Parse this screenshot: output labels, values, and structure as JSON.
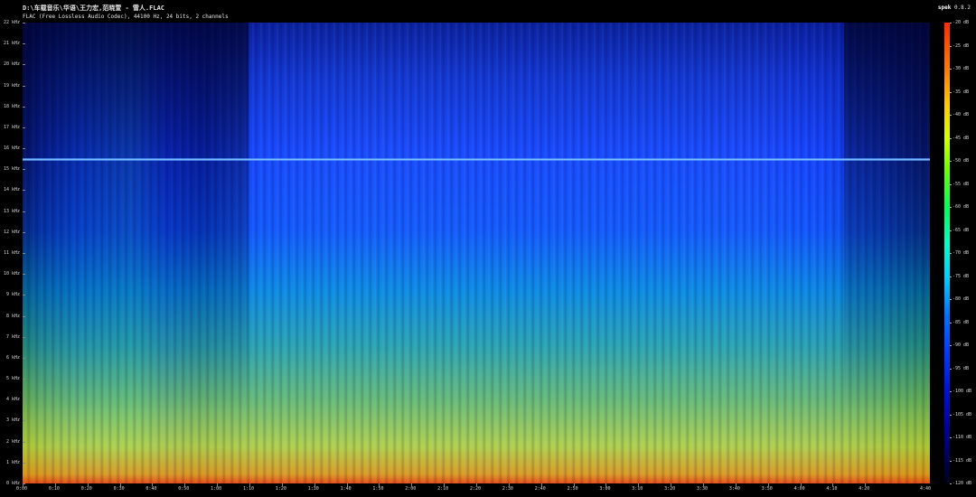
{
  "header": {
    "file_path": "D:\\车载音乐\\华语\\王力宏,范晓萱 - 雪人.FLAC",
    "format_line": "FLAC (Free Lossless Audio Codec), 44100 Hz, 24 bits, 2 channels",
    "app_name": "spek",
    "app_version": "0.8.2"
  },
  "y_axis": {
    "labels": [
      "22 kHz",
      "21 kHz",
      "20 kHz",
      "19 kHz",
      "18 kHz",
      "17 kHz",
      "16 kHz",
      "15 kHz",
      "14 kHz",
      "13 kHz",
      "12 kHz",
      "11 kHz",
      "10 kHz",
      "9 kHz",
      "8 kHz",
      "7 kHz",
      "6 kHz",
      "5 kHz",
      "4 kHz",
      "3 kHz",
      "2 kHz",
      "1 kHz",
      "0 kHz"
    ]
  },
  "x_axis": {
    "labels": [
      "0:00",
      "0:10",
      "0:20",
      "0:30",
      "0:40",
      "0:50",
      "1:00",
      "1:10",
      "1:20",
      "1:30",
      "1:40",
      "1:50",
      "2:00",
      "2:10",
      "2:20",
      "2:30",
      "2:40",
      "2:50",
      "3:00",
      "3:10",
      "3:20",
      "3:30",
      "3:40",
      "3:50",
      "4:00",
      "4:10",
      "4:20"
    ],
    "end_label": "4:40"
  },
  "colorbar": {
    "labels": [
      "-20 dB",
      "-25 dB",
      "-30 dB",
      "-35 dB",
      "-40 dB",
      "-45 dB",
      "-50 dB",
      "-55 dB",
      "-60 dB",
      "-65 dB",
      "-70 dB",
      "-75 dB",
      "-80 dB",
      "-85 dB",
      "-90 dB",
      "-95 dB",
      "-100 dB",
      "-105 dB",
      "-110 dB",
      "-115 dB",
      "-120 dB"
    ]
  },
  "spectrogram": {
    "cutoff_line_khz": 15.5,
    "palette": [
      "#000018",
      "#0010d8",
      "#0040ff",
      "#00d2ff",
      "#00ff5a",
      "#d8ff00",
      "#ffcc00",
      "#ff2a00"
    ]
  }
}
